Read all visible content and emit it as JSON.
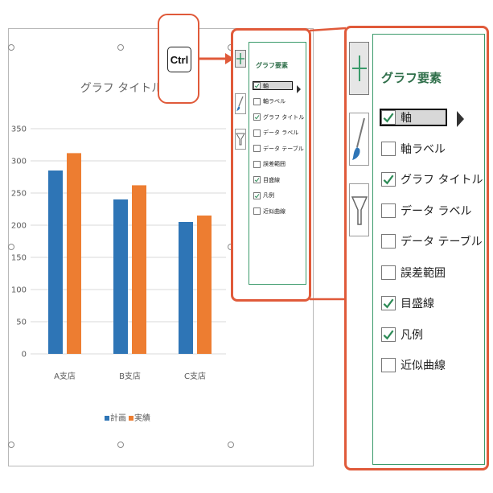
{
  "ctrl_key": "Ctrl",
  "chart_data": {
    "type": "bar",
    "title": "グラフ タイトル",
    "categories": [
      "A支店",
      "B支店",
      "C支店"
    ],
    "series": [
      {
        "name": "計画",
        "values": [
          285,
          240,
          205
        ],
        "color": "#2e75b6"
      },
      {
        "name": "実績",
        "values": [
          312,
          262,
          215
        ],
        "color": "#ed7d31"
      }
    ],
    "yticks": [
      "0",
      "50",
      "100",
      "150",
      "200",
      "250",
      "300",
      "350"
    ],
    "ylim": [
      0,
      350
    ],
    "grid": true,
    "legend": "bottom"
  },
  "chart_elements_panel": {
    "title": "グラフ要素",
    "side_buttons": [
      {
        "icon": "plus-icon"
      },
      {
        "icon": "brush-icon"
      },
      {
        "icon": "filter-icon"
      }
    ],
    "items": [
      {
        "label": "軸",
        "checked": true
      },
      {
        "label": "軸ラベル",
        "checked": false
      },
      {
        "label": "グラフ タイトル",
        "checked": true
      },
      {
        "label": "データ ラベル",
        "checked": false
      },
      {
        "label": "データ テーブル",
        "checked": false
      },
      {
        "label": "誤差範囲",
        "checked": false
      },
      {
        "label": "目盛線",
        "checked": true
      },
      {
        "label": "凡例",
        "checked": true
      },
      {
        "label": "近似曲線",
        "checked": false
      }
    ]
  },
  "colors": {
    "accent": "#e05a3a",
    "panel_border": "#3a9a6a",
    "title_green": "#2f6f4a"
  }
}
